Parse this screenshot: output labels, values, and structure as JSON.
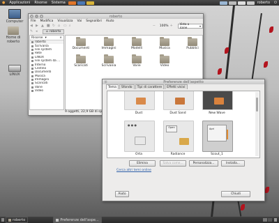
{
  "top_panel": {
    "applications": "Applicazioni",
    "places": "Risorse",
    "system": "Sistema",
    "user": "roberto",
    "colors": {
      "background": "#333333",
      "battery": "#e0e0e0"
    }
  },
  "desktop": {
    "icons": [
      {
        "label": "Computer",
        "icon": "computer-icon"
      },
      {
        "label": "Home di roberto",
        "icon": "home-folder-icon"
      },
      {
        "label": "LINUX",
        "icon": "drive-icon"
      }
    ]
  },
  "file_manager": {
    "title": "roberto",
    "menu": [
      "File",
      "Modifica",
      "Visualizza",
      "Vai",
      "Segnalibri",
      "Aiuto"
    ],
    "zoom": "100%",
    "view_mode": "Vista a icone",
    "breadcrumb": "roberto",
    "sidebar_header": "Risorse",
    "sidebar": [
      "roberto",
      "Scrivania",
      "File system",
      "Rete",
      "LINUX",
      "File system da ...",
      "Interno",
      "Cestino",
      "Documenti",
      "Musica",
      "Immagini",
      "Scaricati",
      "Varie",
      "Video"
    ],
    "files": [
      "Documenti",
      "Immagini",
      "Modelli",
      "Musica",
      "Pubblici",
      "Scaricati",
      "Scrivania",
      "Varie",
      "Video"
    ],
    "status": "9 oggetti, 22,9 GB di spazio lib..."
  },
  "appearance_dialog": {
    "title": "Preferenze dell'aspetto",
    "tabs": [
      "Tema",
      "Sfondo",
      "Tipi di carattere",
      "Effetti visivi"
    ],
    "active_tab": "Tema",
    "themes": [
      "Dust",
      "Dust Sand",
      "New Wave",
      "Orta",
      "Radiance",
      "Scout_1"
    ],
    "selected_theme": "Scout_1",
    "thumb_text": {
      "apri": "Apri",
      "open": "Open"
    },
    "buttons": {
      "delete": "Elimina",
      "save_as": "Salva come...",
      "customize": "Personalizza...",
      "install": "Installa..."
    },
    "more_themes_link": "Cerca altri temi online",
    "help": "Aiuto",
    "close": "Chiudi"
  },
  "taskbar": {
    "items": [
      "roberto",
      "Preferenze dell'aspe..."
    ],
    "active_index": 1
  }
}
